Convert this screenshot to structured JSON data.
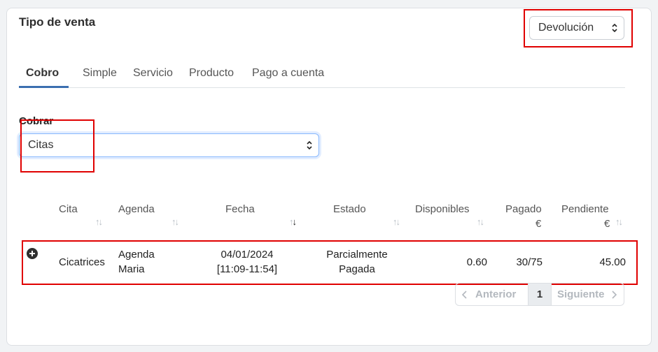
{
  "card": {
    "title": "Tipo de venta",
    "sale_type_select": {
      "value": "Devolución"
    }
  },
  "tabs": [
    {
      "label": "Cobro",
      "active": true
    },
    {
      "label": "Simple"
    },
    {
      "label": "Servicio"
    },
    {
      "label": "Producto"
    },
    {
      "label": "Pago a cuenta"
    }
  ],
  "cobrar": {
    "label": "Cobrar",
    "value": "Citas"
  },
  "table": {
    "headers": {
      "cita": "Cita",
      "agenda": "Agenda",
      "fecha": "Fecha",
      "estado": "Estado",
      "disponibles": "Disponibles",
      "pagado": "Pagado",
      "pagado_unit": "€",
      "pendiente": "Pendiente",
      "pendiente_unit": "€"
    },
    "rows": [
      {
        "cita": "Cicatrices",
        "agenda_line1": "Agenda",
        "agenda_line2": "Maria",
        "fecha_line1": "04/01/2024",
        "fecha_line2": "[11:09-11:54]",
        "estado_line1": "Parcialmente",
        "estado_line2": "Pagada",
        "disponibles": "0.60",
        "pagado": "30/75",
        "pendiente": "45.00"
      }
    ]
  },
  "pagination": {
    "prev": "Anterior",
    "page": "1",
    "next": "Siguiente"
  },
  "icons": {
    "expand_row": "plus-circle-icon",
    "select_chevron": "chevron-up-down-icon",
    "sort": "sort-arrows-icon"
  },
  "colors": {
    "highlight_box": "#e00000",
    "tab_underline": "#3b6fb0",
    "focus_border": "#86b7fe"
  }
}
